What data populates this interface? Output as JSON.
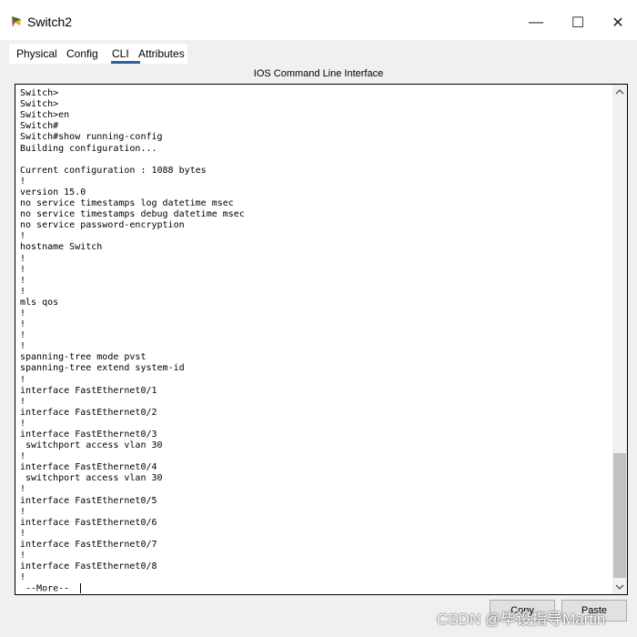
{
  "window": {
    "title": "Switch2",
    "controls": {
      "minimize": "—",
      "maximize": "☐",
      "close": "✕"
    }
  },
  "tabs": [
    {
      "label": "Physical"
    },
    {
      "label": "Config"
    },
    {
      "label": "CLI",
      "selected": true
    },
    {
      "label": "Attributes"
    }
  ],
  "panel_title": "IOS Command Line Interface",
  "console": {
    "lines": [
      "Switch>",
      "Switch>",
      "Switch>",
      "Switch>en",
      "Switch#",
      "Switch#show running-config",
      "Building configuration...",
      "",
      "Current configuration : 1088 bytes",
      "!",
      "version 15.0",
      "no service timestamps log datetime msec",
      "no service timestamps debug datetime msec",
      "no service password-encryption",
      "!",
      "hostname Switch",
      "!",
      "!",
      "!",
      "!",
      "mls qos",
      "!",
      "!",
      "!",
      "!",
      "spanning-tree mode pvst",
      "spanning-tree extend system-id",
      "!",
      "interface FastEthernet0/1",
      "!",
      "interface FastEthernet0/2",
      "!",
      "interface FastEthernet0/3",
      " switchport access vlan 30",
      "!",
      "interface FastEthernet0/4",
      " switchport access vlan 30",
      "!",
      "interface FastEthernet0/5",
      "!",
      "interface FastEthernet0/6",
      "!",
      "interface FastEthernet0/7",
      "!",
      "interface FastEthernet0/8",
      "!",
      " --More-- "
    ]
  },
  "buttons": {
    "copy": "Copy",
    "paste": "Paste"
  },
  "watermark": "CSDN @毕设指导Martin",
  "colors": {
    "tab_underline": "#2f5fa0",
    "scroll_thumb": "#c1c1c1"
  }
}
